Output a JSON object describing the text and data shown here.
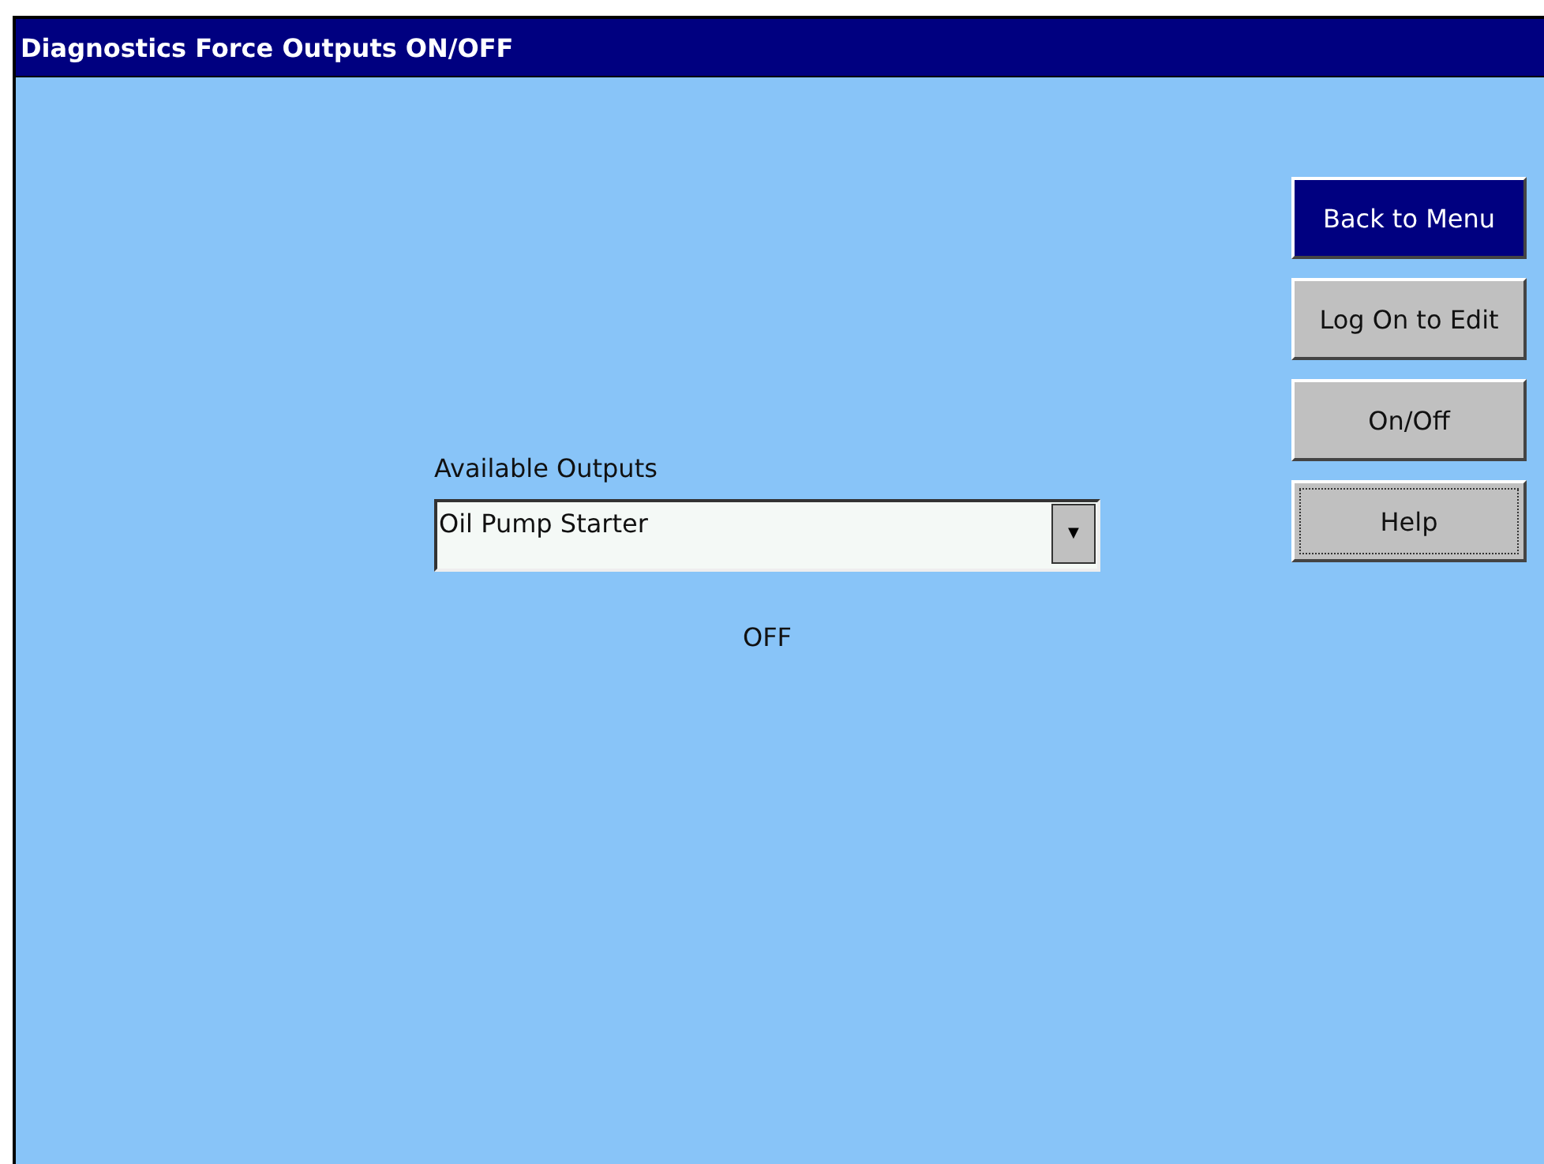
{
  "window": {
    "title": "Diagnostics Force Outputs ON/OFF"
  },
  "buttons": [
    {
      "label": "Back to Menu",
      "highlighted": true,
      "focused": false
    },
    {
      "label": "Log On to Edit",
      "highlighted": false,
      "focused": false
    },
    {
      "label": "On/Off",
      "highlighted": false,
      "focused": false
    },
    {
      "label": "Help",
      "highlighted": false,
      "focused": true
    }
  ],
  "outputs": {
    "label": "Available Outputs",
    "value": "Oil Pump Starter",
    "arrow": "▼"
  },
  "status": "OFF"
}
